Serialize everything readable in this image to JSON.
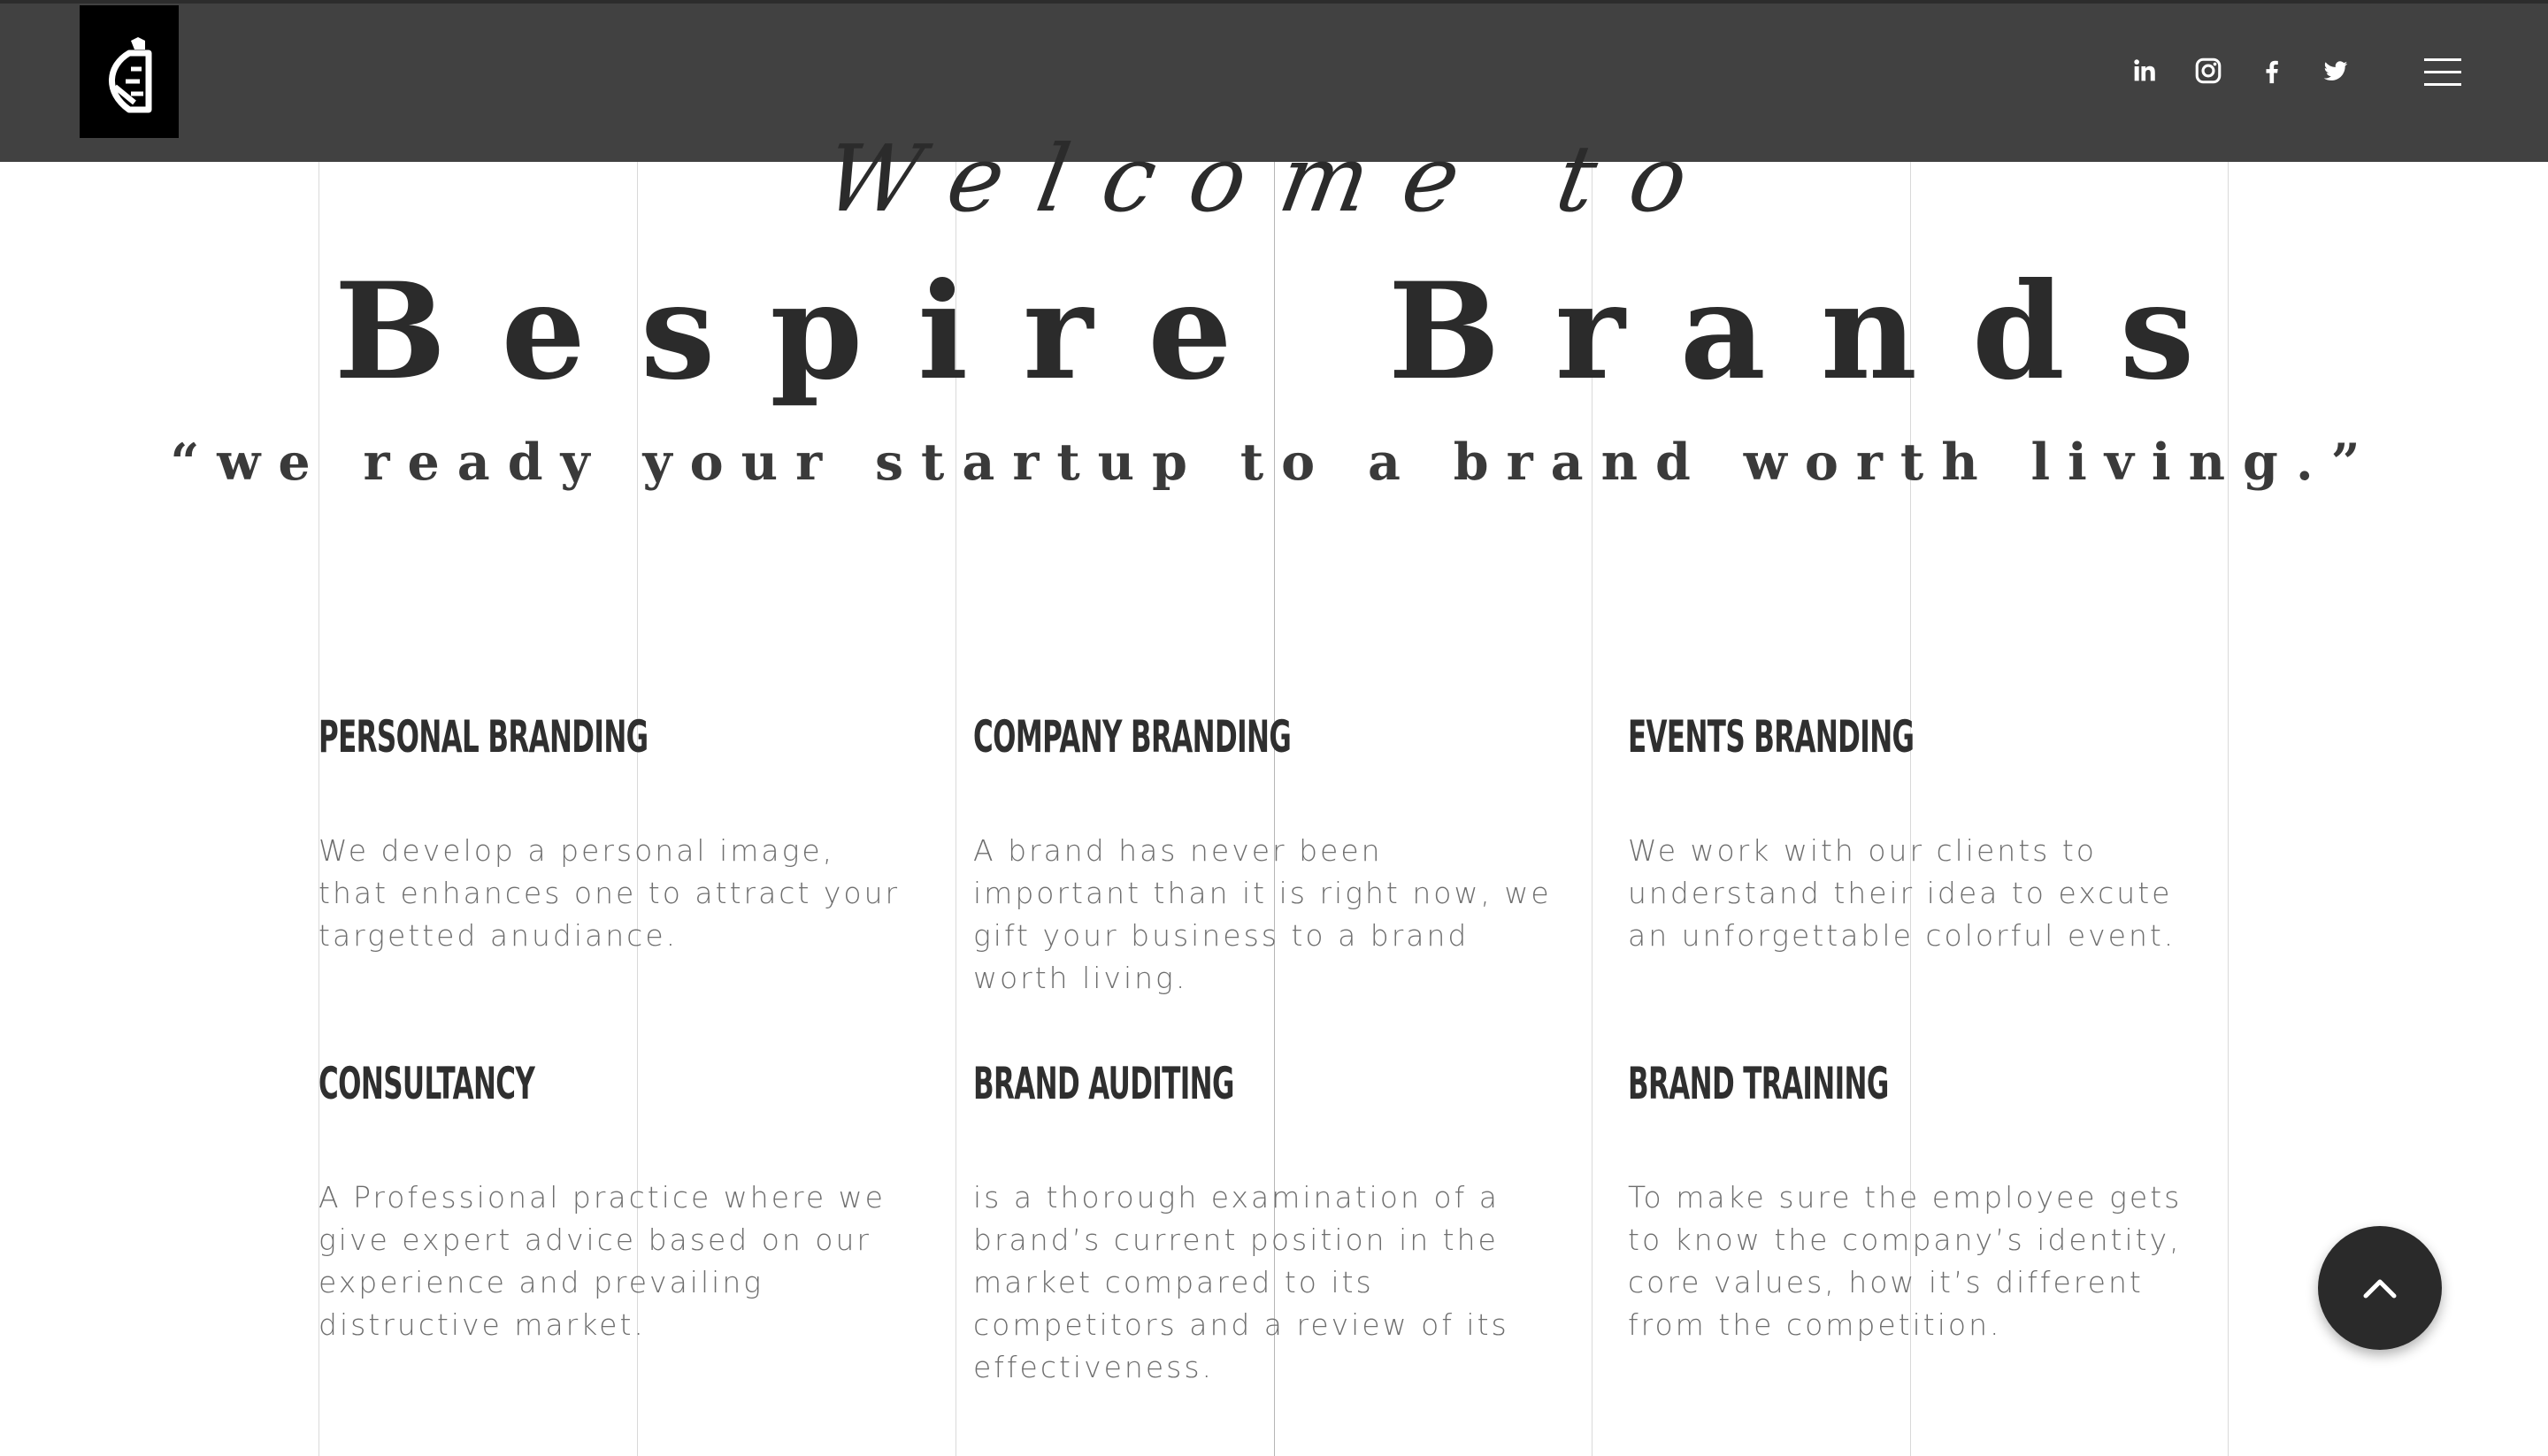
{
  "header": {
    "logo_alt": "Bespire Brands logo",
    "social": [
      {
        "name": "linkedin-icon",
        "label": "LinkedIn"
      },
      {
        "name": "instagram-icon",
        "label": "Instagram"
      },
      {
        "name": "facebook-icon",
        "label": "Facebook"
      },
      {
        "name": "twitter-icon",
        "label": "Twitter"
      }
    ],
    "menu_label": "Menu"
  },
  "hero": {
    "welcome": "Welcome to",
    "title": "Bespire Brands",
    "tagline": "“we ready your startup to a brand worth living.”"
  },
  "services": [
    {
      "title": "PERSONAL BRANDING",
      "text": "We develop a personal image, that enhances one to attract your targetted anudiance."
    },
    {
      "title": "COMPANY BRANDING",
      "text": "A brand has never been important than it is right now, we gift your business to a brand worth living."
    },
    {
      "title": "EVENTS BRANDING",
      "text": "We work with our clients to understand their idea to excute an unforgettable colorful event."
    },
    {
      "title": "CONSULTANCY",
      "text": "A Professional practice where we give expert advice based on our experience and prevailing distructive market."
    },
    {
      "title": "BRAND AUDITING",
      "text": "is a thorough examination of a brand’s current position in the market compared to its competitors and a review of its effectiveness."
    },
    {
      "title": "BRAND TRAINING",
      "text": "To make sure the employee gets to know the company’s identity, core values, how it’s different from the competition."
    }
  ],
  "colors": {
    "header_bg": "#414141",
    "text_dark": "#2b2b2b",
    "text_muted": "#6e6e6e",
    "button_bg": "#2a2a2a"
  }
}
